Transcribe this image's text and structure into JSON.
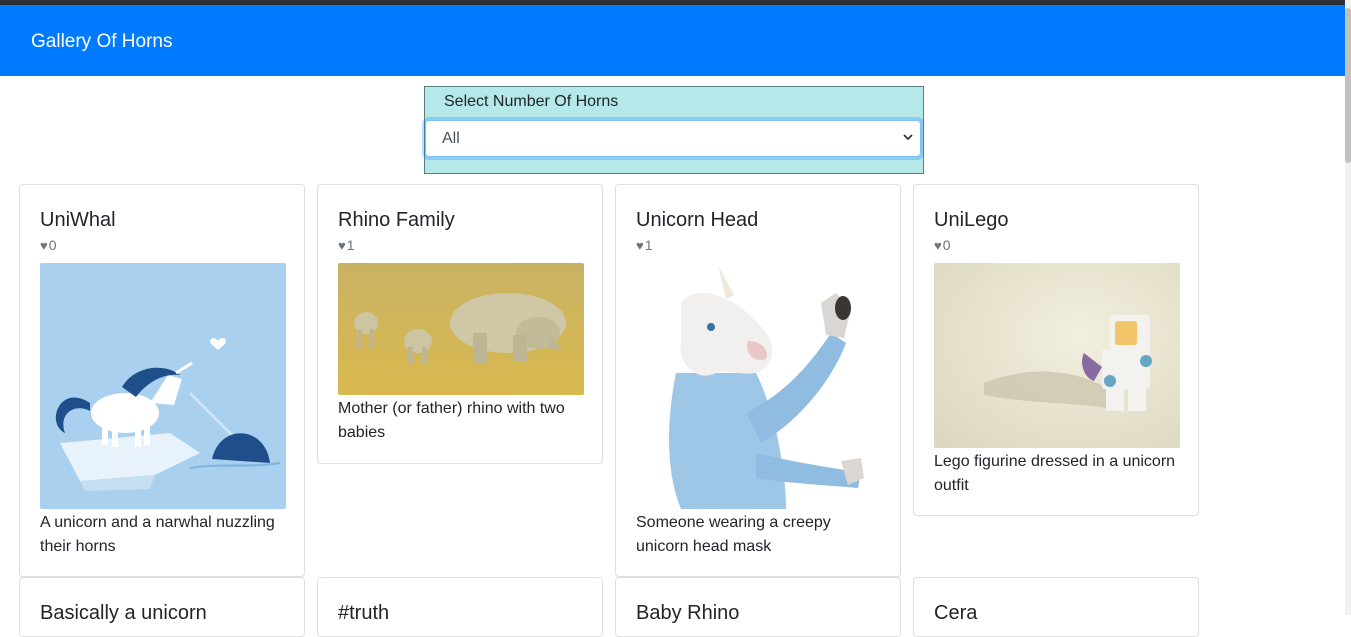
{
  "header": {
    "title": "Gallery Of Horns"
  },
  "filter": {
    "label": "Select Number Of Horns",
    "selected": "All"
  },
  "cards": [
    {
      "title": "UniWhal",
      "likes": "0",
      "description": "A unicorn and a narwhal nuzzling their horns"
    },
    {
      "title": "Rhino Family",
      "likes": "1",
      "description": "Mother (or father) rhino with two babies"
    },
    {
      "title": "Unicorn Head",
      "likes": "1",
      "description": "Someone wearing a creepy unicorn head mask"
    },
    {
      "title": "UniLego",
      "likes": "0",
      "description": "Lego figurine dressed in a unicorn outfit"
    },
    {
      "title": "Basically a unicorn"
    },
    {
      "title": "#truth"
    },
    {
      "title": "Baby Rhino"
    },
    {
      "title": "Cera"
    }
  ],
  "icons": {
    "likes": "heart-icon",
    "select": "chevron-down-icon"
  },
  "colors": {
    "navbar": "#007bff",
    "filter_bg": "#b5e9e9"
  }
}
